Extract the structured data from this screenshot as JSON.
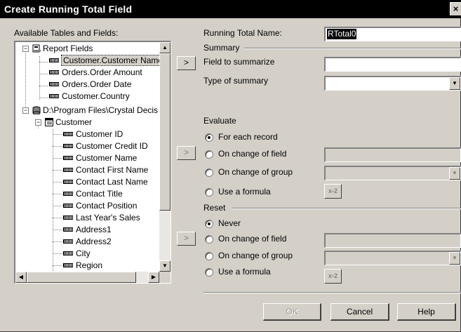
{
  "window": {
    "title": "Create Running Total Field",
    "close_glyph": "×"
  },
  "left": {
    "available_label": "Available Tables and Fields:"
  },
  "tree": {
    "rows": [
      {
        "text": "Report Fields",
        "kind": "root-report"
      },
      {
        "text": "Customer.Customer Name",
        "kind": "field",
        "selected": true
      },
      {
        "text": "Orders.Order Amount",
        "kind": "field"
      },
      {
        "text": "Orders.Order Date",
        "kind": "field"
      },
      {
        "text": "Customer.Country",
        "kind": "field"
      },
      {
        "text": "D:\\Program Files\\Crystal Decis",
        "kind": "root-db"
      },
      {
        "text": "Customer",
        "kind": "table"
      },
      {
        "text": "Customer ID",
        "kind": "subfield"
      },
      {
        "text": "Customer Credit ID",
        "kind": "subfield"
      },
      {
        "text": "Customer Name",
        "kind": "subfield"
      },
      {
        "text": "Contact First Name",
        "kind": "subfield"
      },
      {
        "text": "Contact Last Name",
        "kind": "subfield"
      },
      {
        "text": "Contact Title",
        "kind": "subfield"
      },
      {
        "text": "Contact Position",
        "kind": "subfield"
      },
      {
        "text": "Last Year's Sales",
        "kind": "subfield"
      },
      {
        "text": "Address1",
        "kind": "subfield"
      },
      {
        "text": "Address2",
        "kind": "subfield"
      },
      {
        "text": "City",
        "kind": "subfield"
      },
      {
        "text": "Region",
        "kind": "subfield"
      }
    ]
  },
  "arrow_buttons": {
    "glyph": ">"
  },
  "running_total": {
    "name_label": "Running Total Name:",
    "name_value": "RTotal0"
  },
  "summary": {
    "header": "Summary",
    "field_label": "Field to summarize",
    "field_value": "",
    "type_label": "Type of summary",
    "type_value": ""
  },
  "evaluate": {
    "header": "Evaluate",
    "options": [
      "For each record",
      "On change of field",
      "On change of group",
      "Use a formula"
    ],
    "selected": 0
  },
  "reset": {
    "header": "Reset",
    "options": [
      "Never",
      "On change of field",
      "On change of group",
      "Use a formula"
    ],
    "selected": 0
  },
  "formula_button": {
    "glyph": "x-2"
  },
  "footer": {
    "ok": "OK",
    "cancel": "Cancel",
    "help": "Help"
  }
}
